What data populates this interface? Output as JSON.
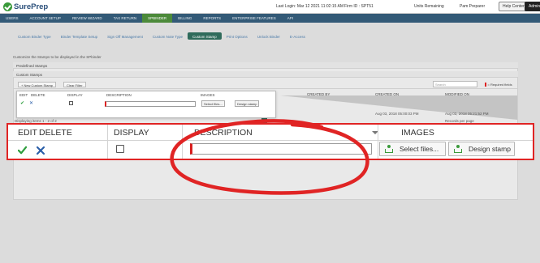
{
  "header": {
    "logo_text": "SurePrep",
    "last_login": "Last Login: Mar 12 2021 11:02:15 AM",
    "firm_id": "Firm ID : SPT51",
    "units_remaining": "Units Remaining",
    "user": "Pam Preparer",
    "help_center": "Help Center",
    "admin": "Admin"
  },
  "nav": [
    "Users",
    "Account Setup",
    "Review Wizard",
    "Tax Return",
    "SPBinder",
    "Billing",
    "Reports",
    "Enterprise Features",
    "API"
  ],
  "nav_active": "SPBinder",
  "subtabs": [
    "Custom Binder Type",
    "Binder Template Setup",
    "Sign Off Management",
    "Custom Note Type",
    "Custom Stamp",
    "Print Options",
    "Unlock Binder",
    "E-Access"
  ],
  "subtab_active": "Custom Stamp",
  "page": {
    "caption": "Customize the Stamps to be displayed in the SPbinder",
    "predefined": "Predefined Stamps",
    "custom": "Custom Stamps",
    "new_btn": "+ New Custom Stamp",
    "clear_btn": "Clear Filter",
    "search_placeholder": "Search",
    "required": "= Required fields",
    "created_by": "CREATED BY",
    "created_on": "CREATED ON",
    "modified_on": "MODIFIED ON",
    "row_date_1": "Aug 03, 2018 05:00:03 PM",
    "row_date_2": "Aug 03, 2018 05:21:52 PM",
    "row_name": "Test",
    "displaying": "Displaying items 1 - 2 of 2",
    "records_per_page": "Records per page",
    "page_num": "1"
  },
  "mini_grid": {
    "edit": "EDIT",
    "delete": "DELETE",
    "display": "DISPLAY",
    "description": "DESCRIPTION",
    "images": "IMAGES",
    "select_files": "Select files...",
    "design_stamp": "Design stamp"
  },
  "grid": {
    "edit": "EDIT",
    "delete": "DELETE",
    "display": "DISPLAY",
    "description": "DESCRIPTION",
    "images": "IMAGES",
    "description_value": "",
    "select_files": "Select files...",
    "design_stamp": "Design stamp"
  },
  "colors": {
    "nav_bg": "#335a77",
    "nav_active": "#4c8a3a",
    "highlight_red": "#e02424",
    "check_green": "#2e9e3e",
    "x_blue": "#2a5ea8"
  }
}
